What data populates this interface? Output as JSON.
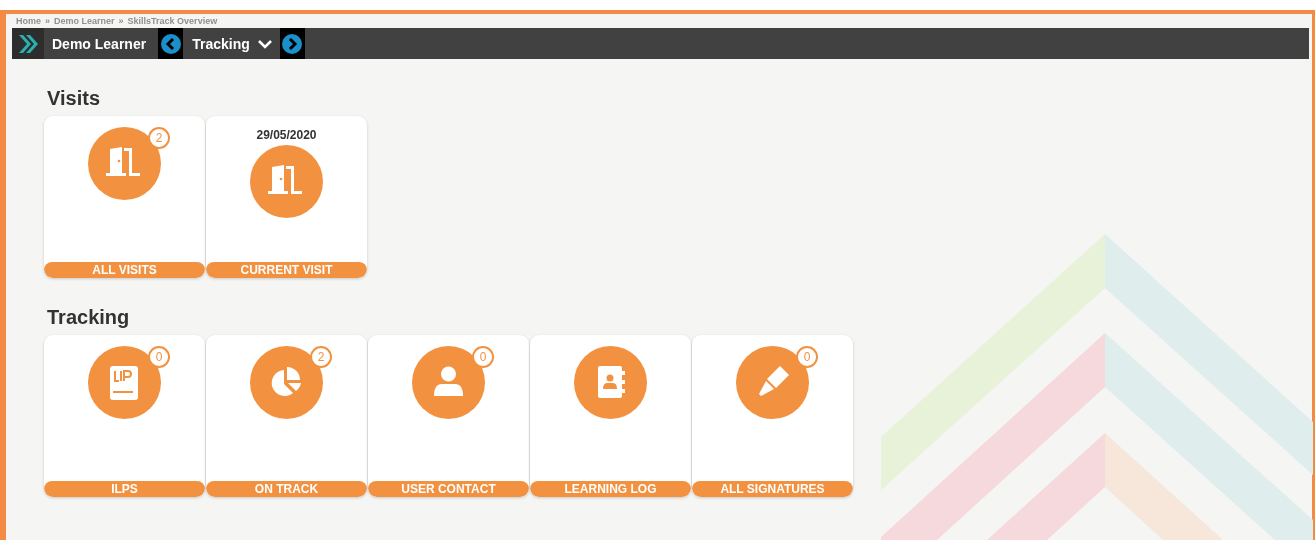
{
  "breadcrumb": {
    "items": [
      "Home",
      "Demo Learner",
      "SkillsTrack Overview"
    ],
    "separator": "»"
  },
  "nav": {
    "learner": "Demo Learner",
    "section": "Tracking"
  },
  "sections": [
    {
      "title": "Visits",
      "tiles": [
        {
          "kind": "door",
          "badge": "2",
          "label": "ALL VISITS"
        },
        {
          "kind": "door",
          "date": "29/05/2020",
          "label": "CURRENT VISIT"
        }
      ]
    },
    {
      "title": "Tracking",
      "tiles": [
        {
          "kind": "book",
          "badge": "0",
          "label": "ILPS"
        },
        {
          "kind": "pie",
          "badge": "2",
          "label": "ON TRACK"
        },
        {
          "kind": "user",
          "badge": "0",
          "label": "USER CONTACT"
        },
        {
          "kind": "contacts",
          "label": "LEARNING LOG"
        },
        {
          "kind": "pen",
          "badge": "0",
          "label": "ALL SIGNATURES"
        }
      ]
    }
  ]
}
